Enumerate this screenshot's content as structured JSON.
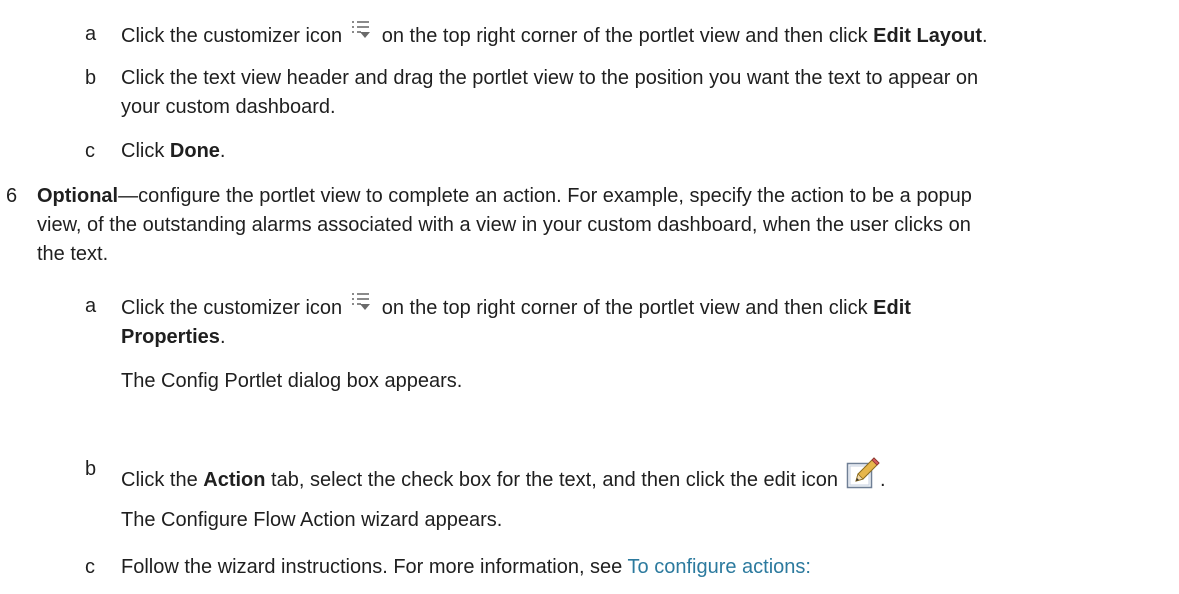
{
  "steps": {
    "a1": {
      "marker": "a",
      "before": "Click the customizer icon",
      "after": "on the top right corner of the portlet view and then click",
      "bold": "Edit Layout",
      "end": "."
    },
    "b1": {
      "marker": "b",
      "line1": "Click the text view header and drag the portlet view to the position you want the text to appear on",
      "line2": "your custom dashboard."
    },
    "c1": {
      "marker": "c",
      "before": "Click",
      "bold": "Done",
      "end": "."
    },
    "s6": {
      "marker": "6",
      "bold": "Optional",
      "line1_rest": "—configure the portlet view to complete an action. For example, specify the action to be a popup",
      "line2": "view, of the outstanding alarms associated with a view in your custom dashboard, when the user clicks on",
      "line3": "the text."
    },
    "a2": {
      "marker": "a",
      "before": "Click the customizer icon",
      "after": "on the top right corner of the portlet view and then click",
      "bold1": "Edit",
      "bold2": "Properties",
      "end": ".",
      "result": "The Config Portlet dialog box appears."
    },
    "b2": {
      "marker": "b",
      "before": "Click the",
      "bold": "Action",
      "after": "tab, select the check box for the text, and then click the edit icon",
      "end": ".",
      "result": "The Configure Flow Action wizard appears."
    },
    "c2": {
      "marker": "c",
      "before": "Follow the wizard instructions. For more information, see",
      "link": "To configure actions:"
    }
  },
  "icons": {
    "customizer": "customizer-icon",
    "edit": "edit-icon"
  },
  "colors": {
    "text": "#1f1f1f",
    "link": "#2c7a9e"
  }
}
